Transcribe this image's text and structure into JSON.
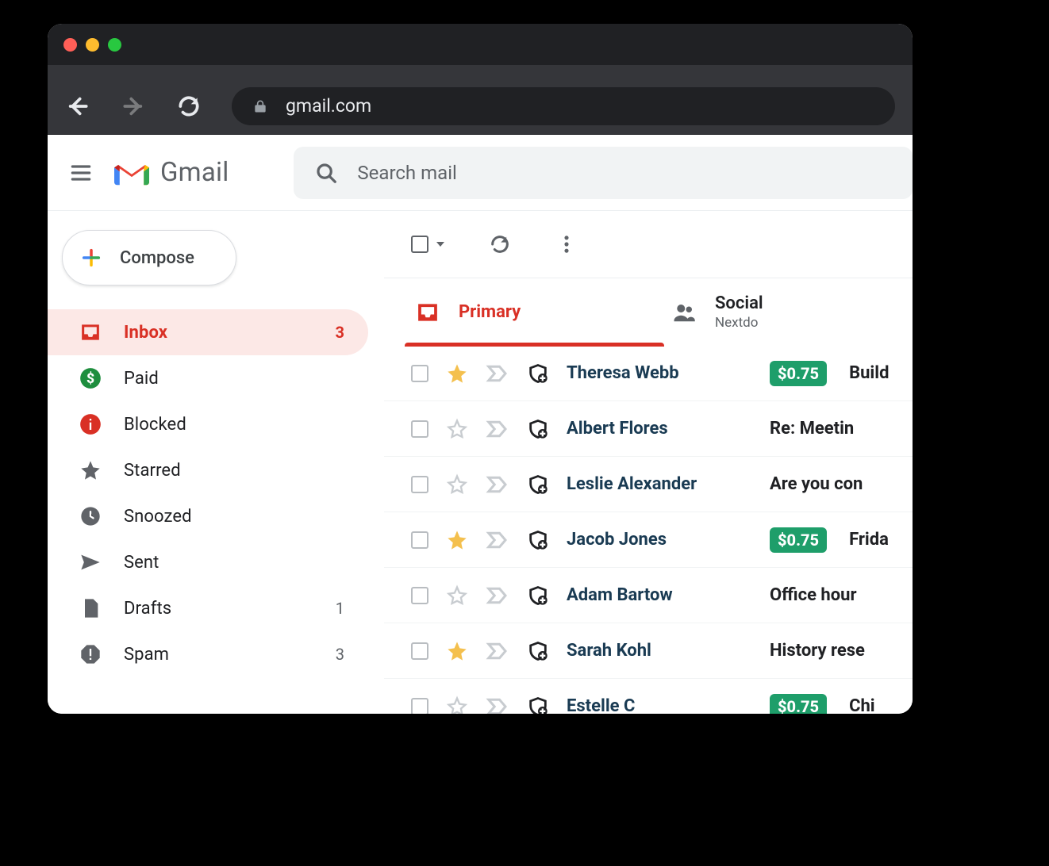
{
  "browser": {
    "url": "gmail.com"
  },
  "header": {
    "product": "Gmail",
    "search_placeholder": "Search mail"
  },
  "compose_label": "Compose",
  "sidebar": {
    "items": [
      {
        "id": "inbox",
        "label": "Inbox",
        "count": "3",
        "active": true
      },
      {
        "id": "paid",
        "label": "Paid",
        "count": ""
      },
      {
        "id": "blocked",
        "label": "Blocked",
        "count": ""
      },
      {
        "id": "starred",
        "label": "Starred",
        "count": ""
      },
      {
        "id": "snoozed",
        "label": "Snoozed",
        "count": ""
      },
      {
        "id": "sent",
        "label": "Sent",
        "count": ""
      },
      {
        "id": "drafts",
        "label": "Drafts",
        "count": "1"
      },
      {
        "id": "spam",
        "label": "Spam",
        "count": "3"
      }
    ]
  },
  "tabs": {
    "primary": {
      "label": "Primary"
    },
    "social": {
      "label": "Social",
      "sub": "Nextdo"
    }
  },
  "emails": [
    {
      "sender": "Theresa Webb",
      "starred": true,
      "price": "$0.75",
      "subject": "Build"
    },
    {
      "sender": "Albert Flores",
      "starred": false,
      "price": "",
      "subject": "Re: Meetin"
    },
    {
      "sender": "Leslie Alexander",
      "starred": false,
      "price": "",
      "subject": "Are you con"
    },
    {
      "sender": "Jacob Jones",
      "starred": true,
      "price": "$0.75",
      "subject": "Frida"
    },
    {
      "sender": "Adam Bartow",
      "starred": false,
      "price": "",
      "subject": "Office hour"
    },
    {
      "sender": "Sarah Kohl",
      "starred": true,
      "price": "",
      "subject": "History rese"
    },
    {
      "sender": "Estelle C",
      "starred": false,
      "price": "$0.75",
      "subject": "Chi"
    }
  ]
}
